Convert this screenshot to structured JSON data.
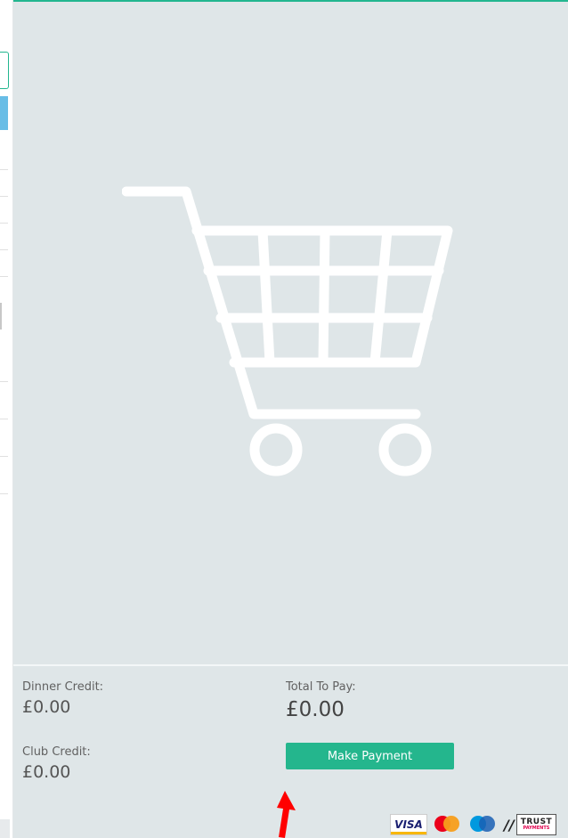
{
  "credits": {
    "dinner_label": "Dinner Credit:",
    "dinner_value": "£0.00",
    "club_label": "Club Credit:",
    "club_value": "£0.00"
  },
  "total": {
    "label": "Total To Pay:",
    "value": "£0.00"
  },
  "payment": {
    "button_label": "Make Payment"
  },
  "card_logos": {
    "visa": "VISA",
    "trust_line1": "TRUST",
    "trust_line2": "PAYMENTS"
  },
  "icons": {
    "cart": "shopping-cart-icon",
    "annotation": "red-arrow-icon"
  },
  "colors": {
    "accent": "#24b68d",
    "panel_bg": "#dfe6e8",
    "annotation": "#ff0000"
  }
}
